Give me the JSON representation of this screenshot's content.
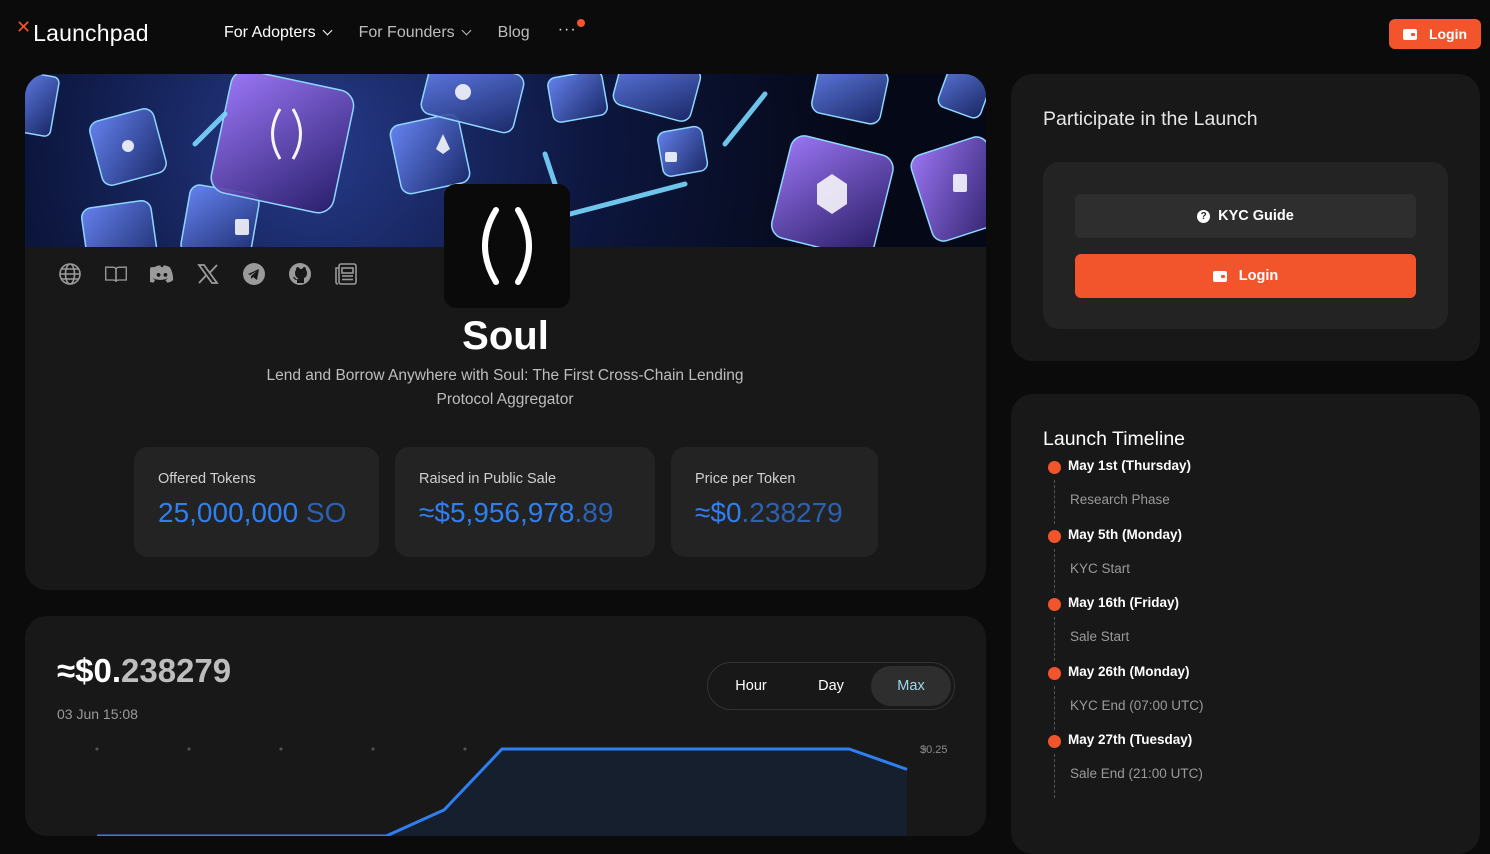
{
  "brand": {
    "name": "Launchpad",
    "accent": "#f2552c"
  },
  "nav": {
    "items": [
      {
        "label": "For Adopters",
        "has_dropdown": true
      },
      {
        "label": "For Founders",
        "has_dropdown": true
      },
      {
        "label": "Blog",
        "has_dropdown": false
      }
    ],
    "more_label": "···",
    "login_label": "Login"
  },
  "project": {
    "name": "Soul",
    "tagline_line1": "Lend and Borrow Anywhere with Soul: The First Cross-Chain Lending",
    "tagline_line2": "Protocol Aggregator",
    "socials": [
      "globe-icon",
      "docs-book-icon",
      "discord-icon",
      "x-twitter-icon",
      "telegram-icon",
      "github-icon",
      "news-icon"
    ]
  },
  "stats": [
    {
      "label": "Offered Tokens",
      "value_main": "25,000,000",
      "value_dim": " SO"
    },
    {
      "label": "Raised in Public Sale",
      "value_main": "≈$5,956,978",
      "value_dim": ".89"
    },
    {
      "label": "Price per Token",
      "value_main": "≈$0",
      "value_dim": ".238279"
    }
  ],
  "price_chart": {
    "price_main": "≈$0.",
    "price_dim": "238279",
    "timestamp": "03 Jun 15:08",
    "ranges": [
      "Hour",
      "Day",
      "Max"
    ],
    "active_range": "Max",
    "line_color": "#2f7ff0"
  },
  "chart_data": {
    "type": "line",
    "tick_labels": [
      "$0.25"
    ],
    "series": [
      {
        "values": [
          0.2,
          0.2,
          0.2,
          0.2,
          0.2,
          0.2,
          0.215,
          0.25,
          0.25,
          0.25,
          0.25,
          0.25,
          0.25,
          0.25,
          0.2383
        ]
      }
    ],
    "ylim": [
      0.2,
      0.25
    ],
    "grid": true
  },
  "participate": {
    "title": "Participate in the Launch",
    "kyc_label": "KYC Guide",
    "login_label": "Login"
  },
  "timeline": {
    "title": "Launch Timeline",
    "items": [
      {
        "date": "May 1st (Thursday)",
        "desc": "Research Phase"
      },
      {
        "date": "May 5th (Monday)",
        "desc": "KYC Start"
      },
      {
        "date": "May 16th (Friday)",
        "desc": "Sale Start"
      },
      {
        "date": "May 26th (Monday)",
        "desc": "KYC End (07:00 UTC)"
      },
      {
        "date": "May 27th (Tuesday)",
        "desc": "Sale End (21:00 UTC)"
      }
    ]
  }
}
